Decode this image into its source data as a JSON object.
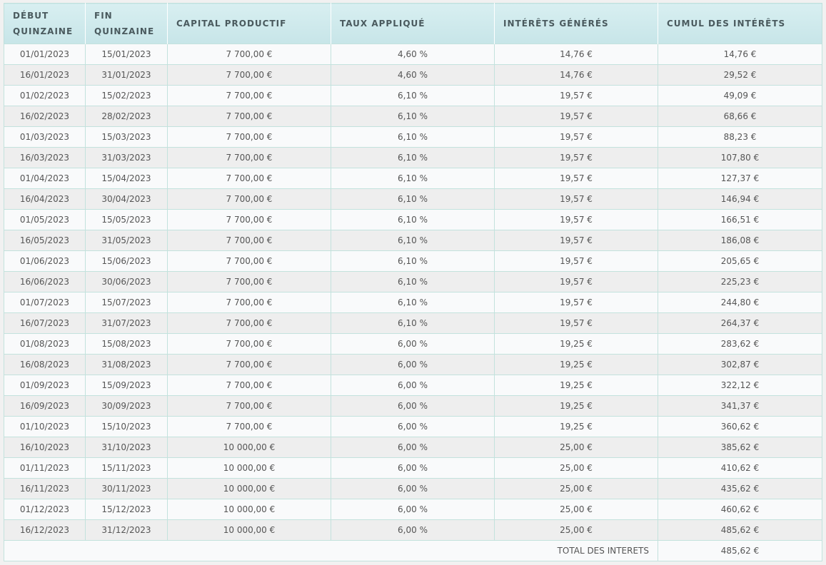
{
  "headers": [
    "DÉBUT QUINZAINE",
    "FIN QUINZAINE",
    "CAPITAL PRODUCTIF",
    "TAUX APPLIQUÉ",
    "INTÉRÊTS GÉNÉRÉS",
    "CUMUL DES INTÉRÊTS"
  ],
  "rows": [
    [
      "01/01/2023",
      "15/01/2023",
      "7 700,00 €",
      "4,60 %",
      "14,76 €",
      "14,76 €"
    ],
    [
      "16/01/2023",
      "31/01/2023",
      "7 700,00 €",
      "4,60 %",
      "14,76 €",
      "29,52 €"
    ],
    [
      "01/02/2023",
      "15/02/2023",
      "7 700,00 €",
      "6,10 %",
      "19,57 €",
      "49,09 €"
    ],
    [
      "16/02/2023",
      "28/02/2023",
      "7 700,00 €",
      "6,10 %",
      "19,57 €",
      "68,66 €"
    ],
    [
      "01/03/2023",
      "15/03/2023",
      "7 700,00 €",
      "6,10 %",
      "19,57 €",
      "88,23 €"
    ],
    [
      "16/03/2023",
      "31/03/2023",
      "7 700,00 €",
      "6,10 %",
      "19,57 €",
      "107,80 €"
    ],
    [
      "01/04/2023",
      "15/04/2023",
      "7 700,00 €",
      "6,10 %",
      "19,57 €",
      "127,37 €"
    ],
    [
      "16/04/2023",
      "30/04/2023",
      "7 700,00 €",
      "6,10 %",
      "19,57 €",
      "146,94 €"
    ],
    [
      "01/05/2023",
      "15/05/2023",
      "7 700,00 €",
      "6,10 %",
      "19,57 €",
      "166,51 €"
    ],
    [
      "16/05/2023",
      "31/05/2023",
      "7 700,00 €",
      "6,10 %",
      "19,57 €",
      "186,08 €"
    ],
    [
      "01/06/2023",
      "15/06/2023",
      "7 700,00 €",
      "6,10 %",
      "19,57 €",
      "205,65 €"
    ],
    [
      "16/06/2023",
      "30/06/2023",
      "7 700,00 €",
      "6,10 %",
      "19,57 €",
      "225,23 €"
    ],
    [
      "01/07/2023",
      "15/07/2023",
      "7 700,00 €",
      "6,10 %",
      "19,57 €",
      "244,80 €"
    ],
    [
      "16/07/2023",
      "31/07/2023",
      "7 700,00 €",
      "6,10 %",
      "19,57 €",
      "264,37 €"
    ],
    [
      "01/08/2023",
      "15/08/2023",
      "7 700,00 €",
      "6,00 %",
      "19,25 €",
      "283,62 €"
    ],
    [
      "16/08/2023",
      "31/08/2023",
      "7 700,00 €",
      "6,00 %",
      "19,25 €",
      "302,87 €"
    ],
    [
      "01/09/2023",
      "15/09/2023",
      "7 700,00 €",
      "6,00 %",
      "19,25 €",
      "322,12 €"
    ],
    [
      "16/09/2023",
      "30/09/2023",
      "7 700,00 €",
      "6,00 %",
      "19,25 €",
      "341,37 €"
    ],
    [
      "01/10/2023",
      "15/10/2023",
      "7 700,00 €",
      "6,00 %",
      "19,25 €",
      "360,62 €"
    ],
    [
      "16/10/2023",
      "31/10/2023",
      "10 000,00 €",
      "6,00 %",
      "25,00 €",
      "385,62 €"
    ],
    [
      "01/11/2023",
      "15/11/2023",
      "10 000,00 €",
      "6,00 %",
      "25,00 €",
      "410,62 €"
    ],
    [
      "16/11/2023",
      "30/11/2023",
      "10 000,00 €",
      "6,00 %",
      "25,00 €",
      "435,62 €"
    ],
    [
      "01/12/2023",
      "15/12/2023",
      "10 000,00 €",
      "6,00 %",
      "25,00 €",
      "460,62 €"
    ],
    [
      "16/12/2023",
      "31/12/2023",
      "10 000,00 €",
      "6,00 %",
      "25,00 €",
      "485,62 €"
    ]
  ],
  "total": {
    "label": "TOTAL DES INTERETS",
    "value": "485,62 €"
  }
}
